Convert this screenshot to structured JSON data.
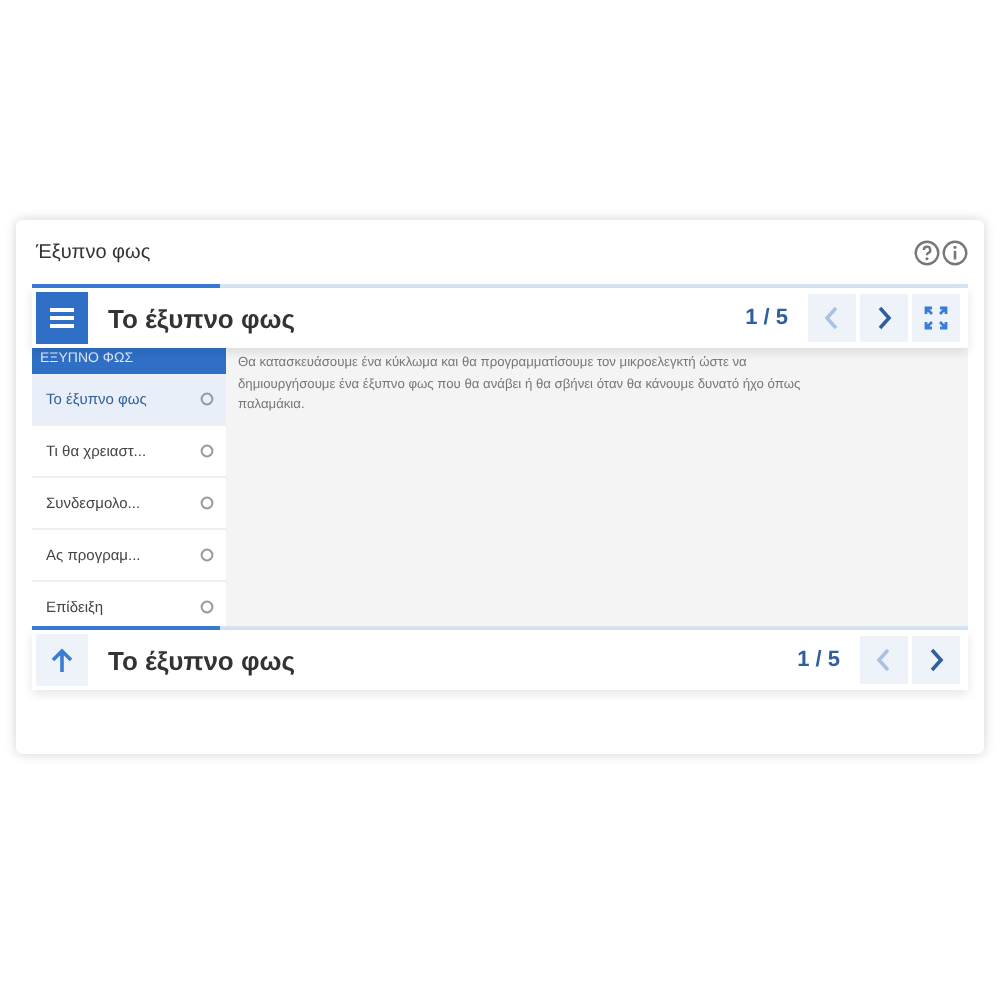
{
  "panel": {
    "title": "Έξυπνο φως"
  },
  "progress": {
    "level": 0.2
  },
  "top_bar": {
    "title": "Το έξυπνο φως",
    "counter": "1 / 5",
    "prev_disabled": true,
    "next_disabled": false
  },
  "sidebar": {
    "header": "ΕΞΥΠΝΟ ΦΩΣ",
    "items": [
      {
        "label": "Το έξυπνο φως",
        "selected": true
      },
      {
        "label": "Τι θα χρειαστ...",
        "selected": false
      },
      {
        "label": "Συνδεσμολο...",
        "selected": false
      },
      {
        "label": "Ας προγραμ...",
        "selected": false
      },
      {
        "label": "Επίδειξη",
        "selected": false
      }
    ]
  },
  "content": {
    "text": "Θα κατασκευάσουμε ένα κύκλωμα και θα προγραμματίσουμε τον μικροελεγκτή ώστε να δημιουργήσουμε ένα έξυπνο φως που θα ανάβει ή θα σβήνει όταν θα κάνουμε δυνατό ήχο όπως παλαμάκια."
  },
  "bottom_bar": {
    "title": "Το έξυπνο φως",
    "counter": "1 / 5",
    "prev_disabled": true,
    "next_disabled": false
  }
}
